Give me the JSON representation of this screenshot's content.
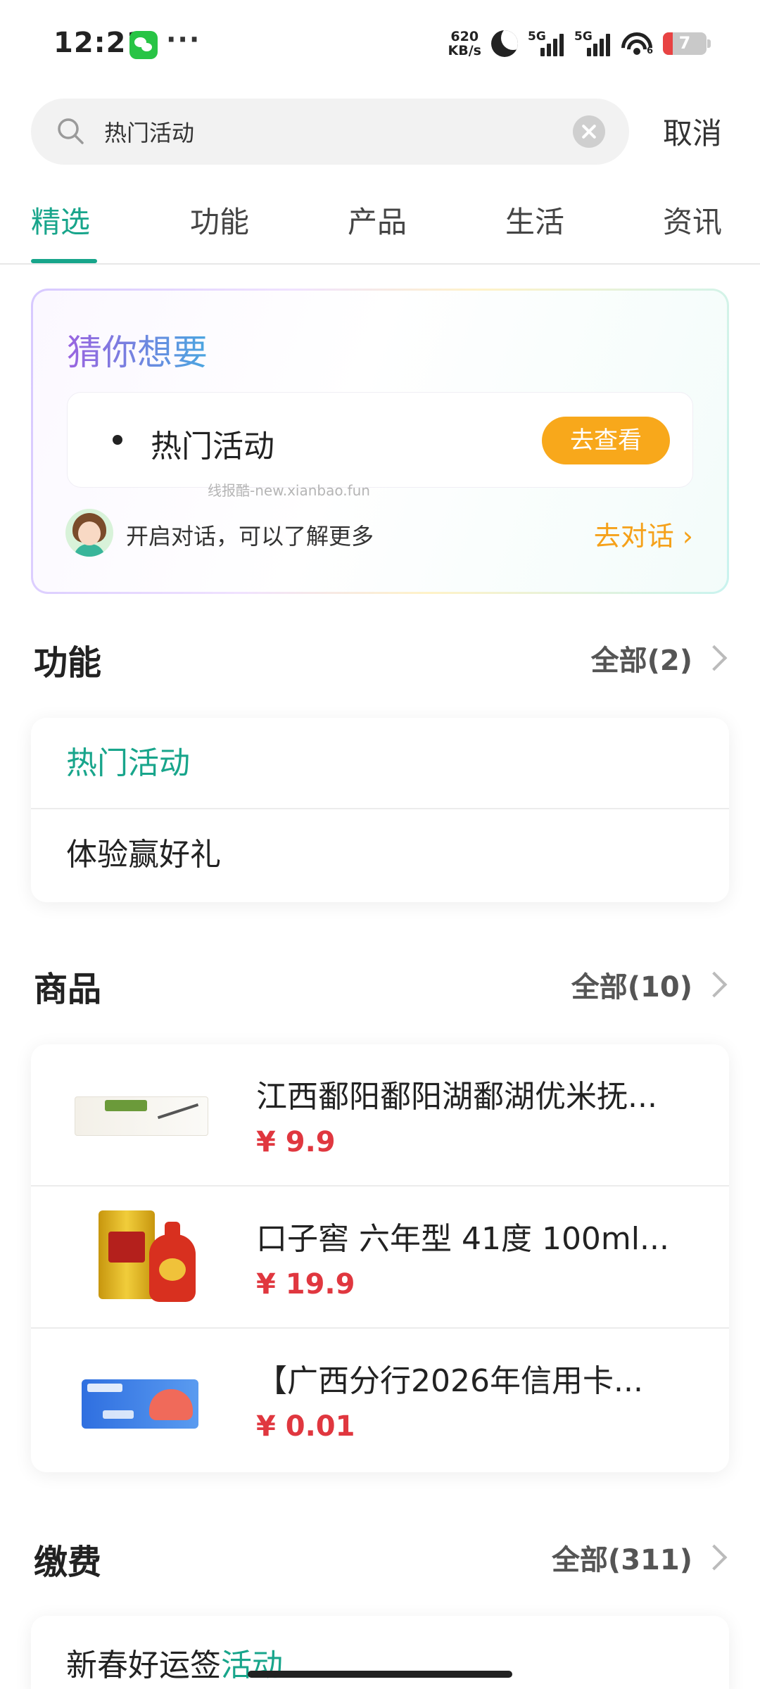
{
  "status_bar": {
    "time": "12:21",
    "net_speed_value": "620",
    "net_speed_unit": "KB/s",
    "signal_1_label": "5G",
    "signal_2_label": "5G",
    "wifi_sub": "6",
    "battery": "7",
    "icons": [
      "wechat-icon",
      "moon-icon",
      "signal-icon",
      "wifi-icon",
      "battery-icon"
    ]
  },
  "search": {
    "query": "热门活动",
    "cancel_label": "取消"
  },
  "tabs": [
    {
      "label": "精选",
      "active": true
    },
    {
      "label": "功能",
      "active": false
    },
    {
      "label": "产品",
      "active": false
    },
    {
      "label": "生活",
      "active": false
    },
    {
      "label": "资讯",
      "active": false
    }
  ],
  "guess": {
    "title": "猜你想要",
    "item_label": "热门活动",
    "button_label": "去查看",
    "watermark": "线报酷-new.xianbao.fun",
    "chat_prompt": "开启对话，可以了解更多",
    "chat_link": "去对话"
  },
  "functions": {
    "title": "功能",
    "all_label": "全部(2)",
    "items": [
      "热门活动",
      "体验赢好礼"
    ]
  },
  "products": {
    "title": "商品",
    "all_label": "全部(10)",
    "items": [
      {
        "name": "江西鄱阳鄱阳湖鄱湖优米抚...",
        "price": "¥ 9.9"
      },
      {
        "name": "口子窖 六年型 41度 100ml...",
        "price": "¥ 19.9"
      },
      {
        "name": "【广西分行2026年信用卡...",
        "price": "¥ 0.01"
      }
    ]
  },
  "payments": {
    "title": "缴费",
    "all_label": "全部(311)",
    "first_item_prefix": "新春好运签",
    "first_item_highlight": "活动"
  },
  "colors": {
    "accent": "#18a58b",
    "price": "#e0373f",
    "cta": "#f8a81b",
    "chat_link": "#f5a11a"
  }
}
